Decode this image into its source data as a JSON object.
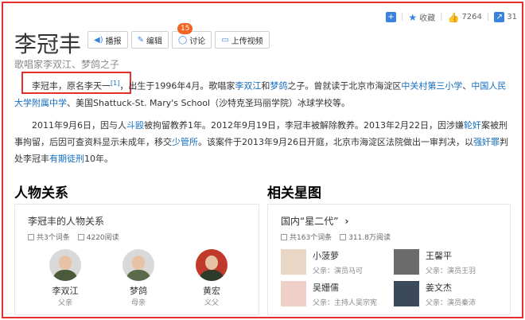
{
  "toolbar": {
    "fav_label": "收藏",
    "like_count": "7264",
    "share_count": "31"
  },
  "title": "李冠丰",
  "actions": {
    "play": "播报",
    "edit": "编辑",
    "discuss": "讨论",
    "discuss_badge": "15",
    "upload": "上传视频"
  },
  "subtitle": "歌唱家李双江、梦鸽之子",
  "para1": {
    "name": "李冠丰，原名李天一",
    "ref": "[1]",
    "t1": "，出生于1996年4月。歌唱家",
    "l1": "李双江",
    "t2": "和",
    "l2": "梦鸽",
    "t3": "之子。曾就读于北京市海淀区",
    "l3": "中关村第三小学",
    "t4": "、",
    "l4": "中国人民大学附属中学",
    "t5": "、美国Shattuck-St. Mary's School（沙特克圣玛丽学院）冰球学校等。"
  },
  "para2": {
    "t1": "2011年9月6日，因与人",
    "l1": "斗殴",
    "t2": "被拘留教养1年。2012年9月19日，李冠丰被解除教养。2013年2月22日，因涉嫌",
    "l2": "轮奸",
    "t3": "案被刑事拘留，后因可查资料显示未成年，移交",
    "l3": "少管所",
    "t4": "。该案件于2013年9月26日开庭，北京市海淀区法院做出一审判决，以",
    "l4": "强奸罪",
    "t5": "判处李冠丰",
    "l5": "有期徒刑",
    "t6": "10年。"
  },
  "relations": {
    "section_title": "人物关系",
    "card_title": "李冠丰的人物关系",
    "entries": "共3个词条",
    "reads": "4220阅读",
    "people": [
      {
        "name": "李双江",
        "rel": "父亲"
      },
      {
        "name": "梦鸽",
        "rel": "母亲"
      },
      {
        "name": "黄宏",
        "rel": "义父"
      }
    ]
  },
  "stars": {
    "section_title": "相关星图",
    "card_title": "国内“星二代”",
    "entries": "共163个词条",
    "reads": "311.8万阅读",
    "items": [
      {
        "name": "小菠萝",
        "rel": "父亲：演员马可"
      },
      {
        "name": "王馨平",
        "rel": "父亲：演员王羽"
      },
      {
        "name": "吴姗儒",
        "rel": "父亲：主持人吴宗宪"
      },
      {
        "name": "姜文杰",
        "rel": "父亲：演员秦沛"
      }
    ]
  },
  "colors": {
    "accent": "#e4312b",
    "link": "#136ec2",
    "badge": "#f26522"
  }
}
